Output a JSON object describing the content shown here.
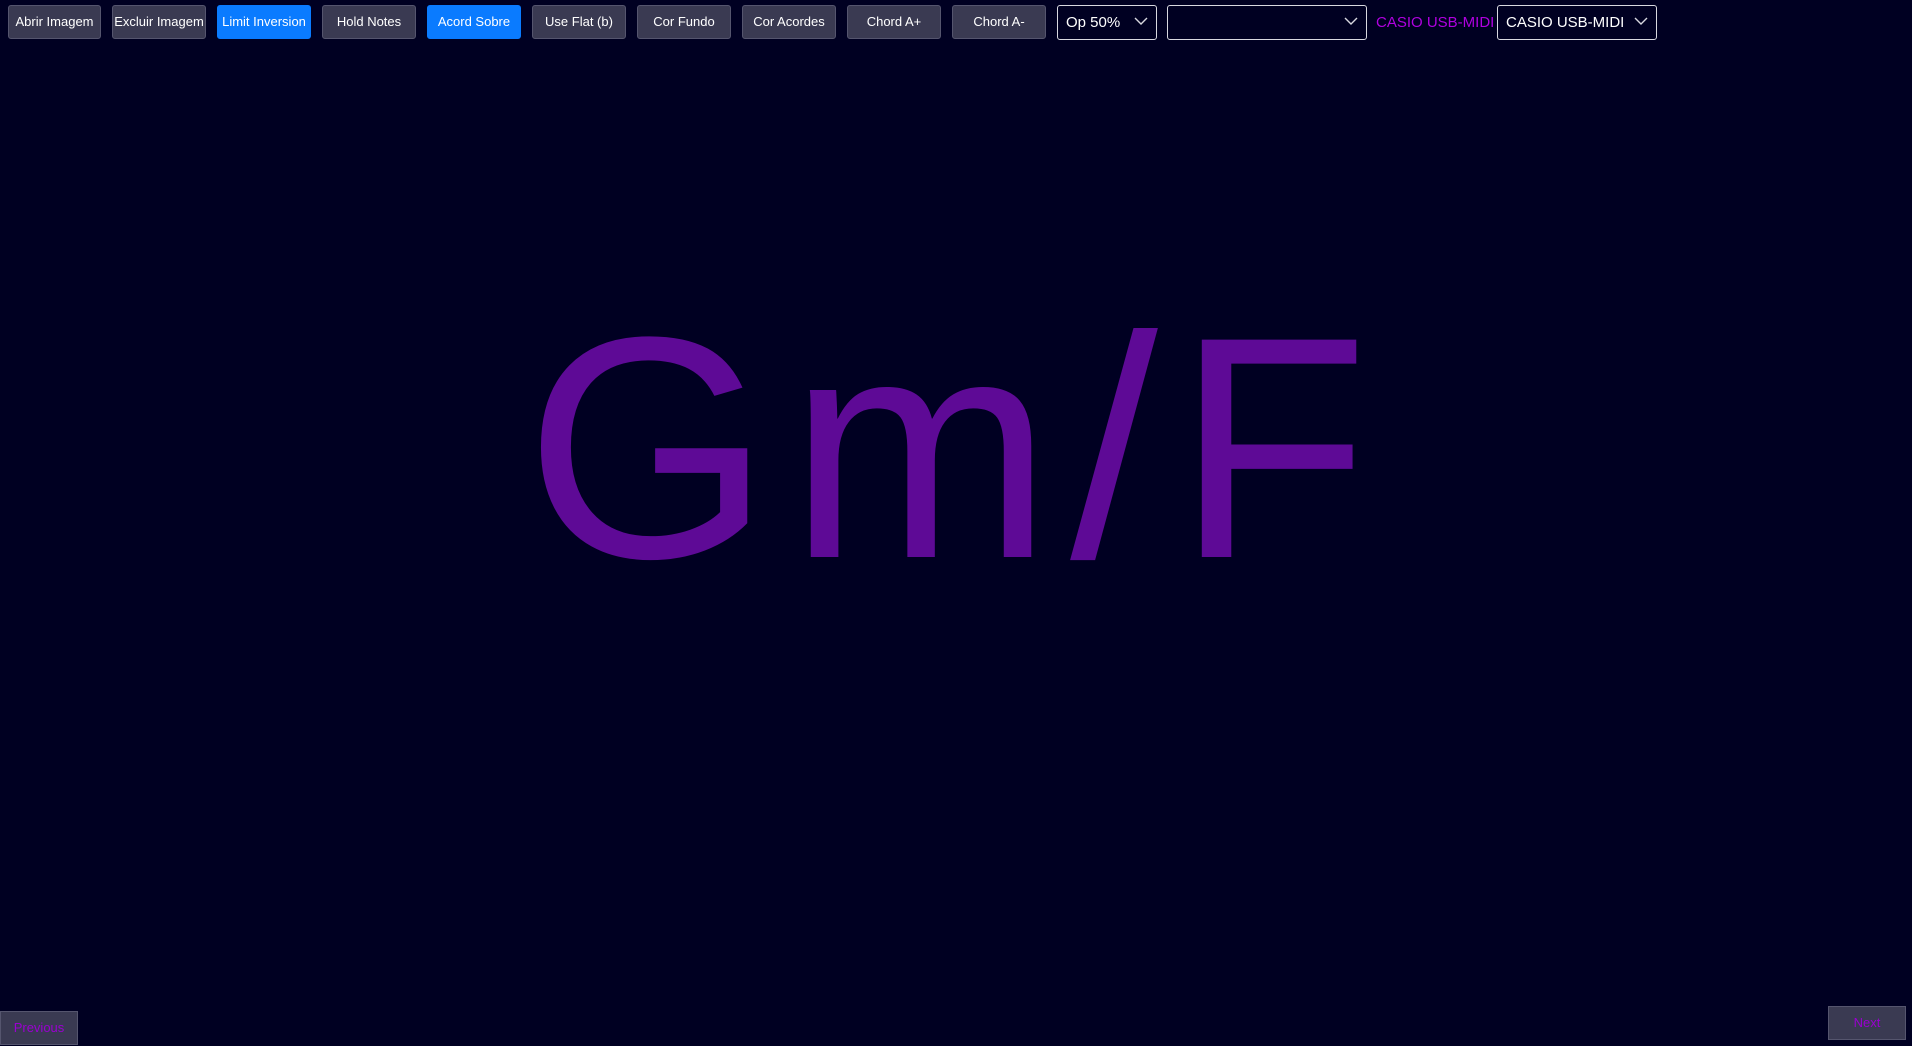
{
  "toolbar": {
    "buttons": [
      {
        "label": "Abrir Imagem",
        "active": false
      },
      {
        "label": "Excluir Imagem",
        "active": false
      },
      {
        "label": "Limit Inversion",
        "active": true
      },
      {
        "label": "Hold Notes",
        "active": false
      },
      {
        "label": "Acord Sobre",
        "active": true
      },
      {
        "label": "Use Flat (b)",
        "active": false
      },
      {
        "label": "Cor Fundo",
        "active": false
      },
      {
        "label": "Cor Acordes",
        "active": false
      },
      {
        "label": "Chord A+",
        "active": false
      },
      {
        "label": "Chord A-",
        "active": false
      }
    ],
    "opacity_select": {
      "value": "Op 50%"
    },
    "image_select": {
      "value": ""
    },
    "midi_device_label": "CASIO USB-MIDI",
    "midi_select": {
      "value": "CASIO USB-MIDI"
    }
  },
  "chord": {
    "name": "Gm/F"
  },
  "nav": {
    "previous_label": "Previous",
    "next_label": "Next"
  },
  "colors": {
    "background": "#000022",
    "button": "#3a3a52",
    "button_active": "#0a7bff",
    "chord_text": "#5e0a96",
    "midi_label": "#b000e0",
    "nav_text": "#9a00d0"
  },
  "icons": {
    "select_arrow": "chevron-down-icon"
  }
}
